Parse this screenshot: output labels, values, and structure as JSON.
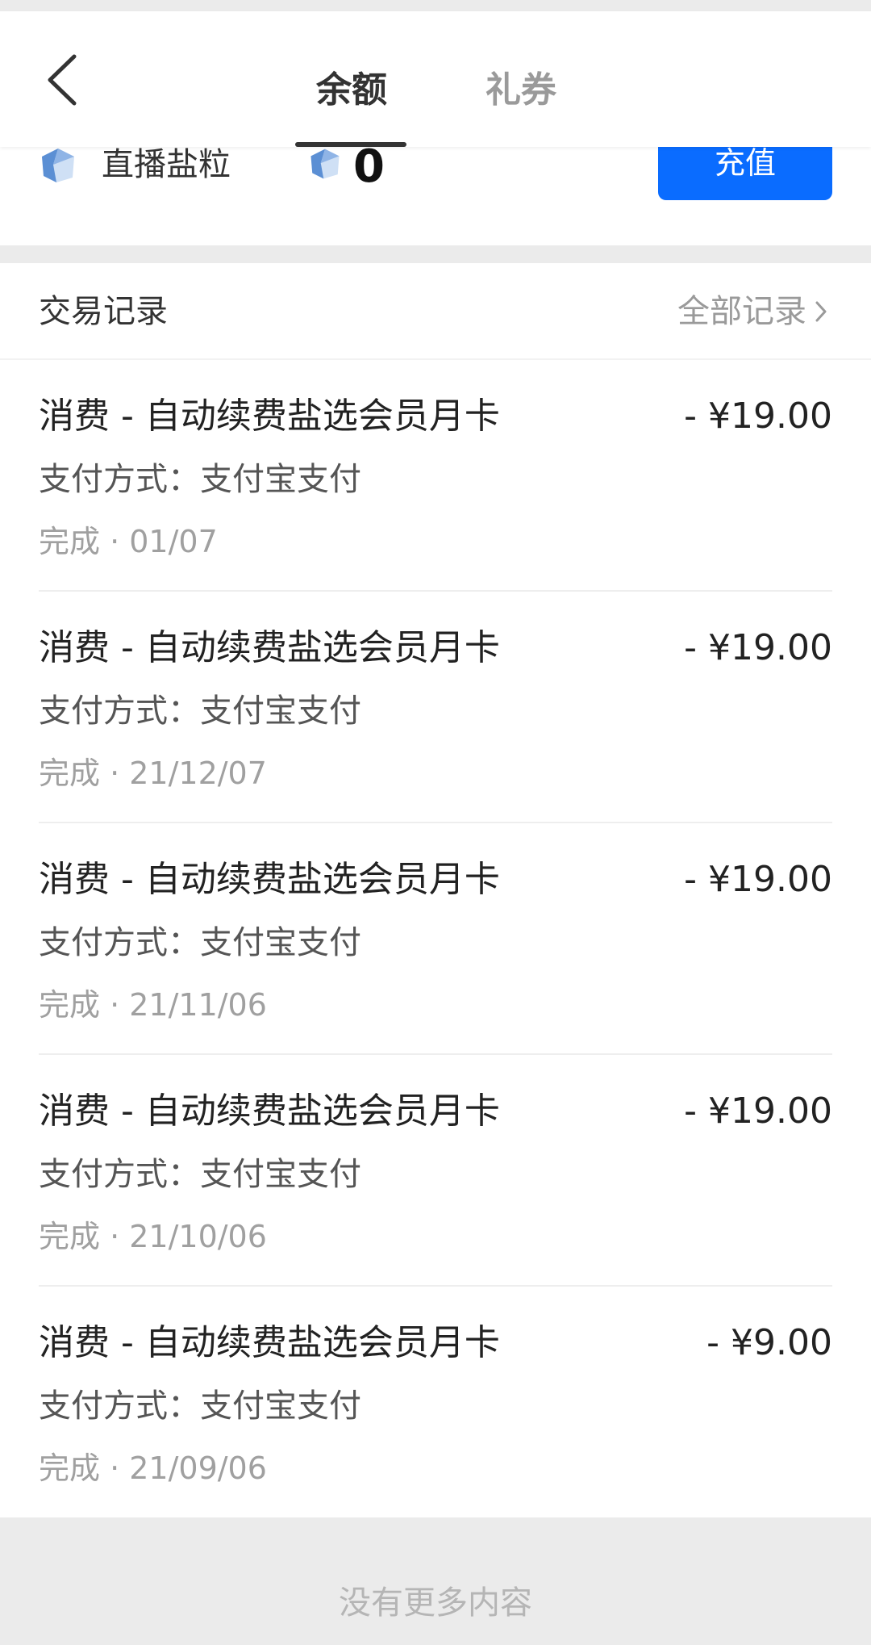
{
  "header": {
    "tabs": [
      {
        "label": "余额",
        "active": true
      },
      {
        "label": "礼券",
        "active": false
      }
    ]
  },
  "balance": {
    "label": "直播盐粒",
    "amount": "0",
    "recharge_label": "充值"
  },
  "transactions": {
    "title": "交易记录",
    "all_records_label": "全部记录",
    "items": [
      {
        "name": "消费 - 自动续费盐选会员月卡",
        "amount": "- ¥19.00",
        "method": "支付方式：支付宝支付",
        "status": "完成 · 01/07"
      },
      {
        "name": "消费 - 自动续费盐选会员月卡",
        "amount": "- ¥19.00",
        "method": "支付方式：支付宝支付",
        "status": "完成 · 21/12/07"
      },
      {
        "name": "消费 - 自动续费盐选会员月卡",
        "amount": "- ¥19.00",
        "method": "支付方式：支付宝支付",
        "status": "完成 · 21/11/06"
      },
      {
        "name": "消费 - 自动续费盐选会员月卡",
        "amount": "- ¥19.00",
        "method": "支付方式：支付宝支付",
        "status": "完成 · 21/10/06"
      },
      {
        "name": "消费 - 自动续费盐选会员月卡",
        "amount": "- ¥9.00",
        "method": "支付方式：支付宝支付",
        "status": "完成 · 21/09/06"
      }
    ]
  },
  "footer": {
    "text": "没有更多内容"
  },
  "colors": {
    "accent": "#0a6cff",
    "gem": "#5b8fd4"
  }
}
